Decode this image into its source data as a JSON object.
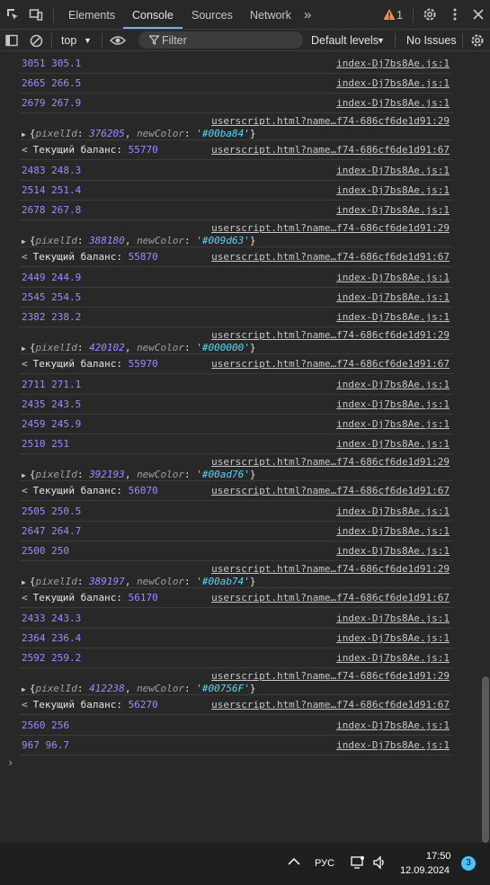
{
  "tabs": {
    "elements": "Elements",
    "console": "Console",
    "sources": "Sources",
    "network": "Network",
    "more": "»",
    "issues_count": "1"
  },
  "toolbar": {
    "context": "top",
    "filter_placeholder": "Filter",
    "levels": "Default levels",
    "no_issues": "No Issues"
  },
  "colors": {
    "accent": "#7cacf8",
    "number": "#9a8cff",
    "string": "#5cd5fb",
    "warning": "#f28b54"
  },
  "console": {
    "rows": [
      {
        "kind": "log",
        "a": "3051",
        "b": "305.1",
        "src": "index-Dj7bs8Ae.js:1"
      },
      {
        "kind": "log",
        "a": "2665",
        "b": "266.5",
        "src": "index-Dj7bs8Ae.js:1"
      },
      {
        "kind": "log",
        "a": "2679",
        "b": "267.9",
        "src": "index-Dj7bs8Ae.js:1"
      },
      {
        "kind": "obj",
        "pixelId": "376205",
        "newColor": "'#00ba84'",
        "src": "userscript.html?name…f74-686cf6de1d91:29"
      },
      {
        "kind": "ret",
        "label": "Текущий баланс:",
        "value": "55770",
        "src": "userscript.html?name…f74-686cf6de1d91:67"
      },
      {
        "kind": "log",
        "a": "2483",
        "b": "248.3",
        "src": "index-Dj7bs8Ae.js:1"
      },
      {
        "kind": "log",
        "a": "2514",
        "b": "251.4",
        "src": "index-Dj7bs8Ae.js:1"
      },
      {
        "kind": "log",
        "a": "2678",
        "b": "267.8",
        "src": "index-Dj7bs8Ae.js:1"
      },
      {
        "kind": "obj",
        "pixelId": "388180",
        "newColor": "'#009d63'",
        "src": "userscript.html?name…f74-686cf6de1d91:29"
      },
      {
        "kind": "ret",
        "label": "Текущий баланс:",
        "value": "55870",
        "src": "userscript.html?name…f74-686cf6de1d91:67"
      },
      {
        "kind": "log",
        "a": "2449",
        "b": "244.9",
        "src": "index-Dj7bs8Ae.js:1"
      },
      {
        "kind": "log",
        "a": "2545",
        "b": "254.5",
        "src": "index-Dj7bs8Ae.js:1"
      },
      {
        "kind": "log",
        "a": "2382",
        "b": "238.2",
        "src": "index-Dj7bs8Ae.js:1"
      },
      {
        "kind": "obj",
        "pixelId": "420102",
        "newColor": "'#000000'",
        "src": "userscript.html?name…f74-686cf6de1d91:29"
      },
      {
        "kind": "ret",
        "label": "Текущий баланс:",
        "value": "55970",
        "src": "userscript.html?name…f74-686cf6de1d91:67"
      },
      {
        "kind": "log",
        "a": "2711",
        "b": "271.1",
        "src": "index-Dj7bs8Ae.js:1"
      },
      {
        "kind": "log",
        "a": "2435",
        "b": "243.5",
        "src": "index-Dj7bs8Ae.js:1"
      },
      {
        "kind": "log",
        "a": "2459",
        "b": "245.9",
        "src": "index-Dj7bs8Ae.js:1"
      },
      {
        "kind": "log",
        "a": "2510",
        "b": "251",
        "src": "index-Dj7bs8Ae.js:1"
      },
      {
        "kind": "obj",
        "pixelId": "392193",
        "newColor": "'#00ad76'",
        "src": "userscript.html?name…f74-686cf6de1d91:29"
      },
      {
        "kind": "ret",
        "label": "Текущий баланс:",
        "value": "56070",
        "src": "userscript.html?name…f74-686cf6de1d91:67"
      },
      {
        "kind": "log",
        "a": "2505",
        "b": "250.5",
        "src": "index-Dj7bs8Ae.js:1"
      },
      {
        "kind": "log",
        "a": "2647",
        "b": "264.7",
        "src": "index-Dj7bs8Ae.js:1"
      },
      {
        "kind": "log",
        "a": "2500",
        "b": "250",
        "src": "index-Dj7bs8Ae.js:1"
      },
      {
        "kind": "obj",
        "pixelId": "389197",
        "newColor": "'#00ab74'",
        "src": "userscript.html?name…f74-686cf6de1d91:29"
      },
      {
        "kind": "ret",
        "label": "Текущий баланс:",
        "value": "56170",
        "src": "userscript.html?name…f74-686cf6de1d91:67"
      },
      {
        "kind": "log",
        "a": "2433",
        "b": "243.3",
        "src": "index-Dj7bs8Ae.js:1"
      },
      {
        "kind": "log",
        "a": "2364",
        "b": "236.4",
        "src": "index-Dj7bs8Ae.js:1"
      },
      {
        "kind": "log",
        "a": "2592",
        "b": "259.2",
        "src": "index-Dj7bs8Ae.js:1"
      },
      {
        "kind": "obj",
        "pixelId": "412238",
        "newColor": "'#00756F'",
        "src": "userscript.html?name…f74-686cf6de1d91:29"
      },
      {
        "kind": "ret",
        "label": "Текущий баланс:",
        "value": "56270",
        "src": "userscript.html?name…f74-686cf6de1d91:67"
      },
      {
        "kind": "log",
        "a": "2560",
        "b": "256",
        "src": "index-Dj7bs8Ae.js:1"
      },
      {
        "kind": "log",
        "a": "967",
        "b": "96.7",
        "src": "index-Dj7bs8Ae.js:1"
      }
    ]
  },
  "taskbar": {
    "lang": "РУС",
    "time": "17:50",
    "date": "12.09.2024",
    "notifications": "3"
  }
}
